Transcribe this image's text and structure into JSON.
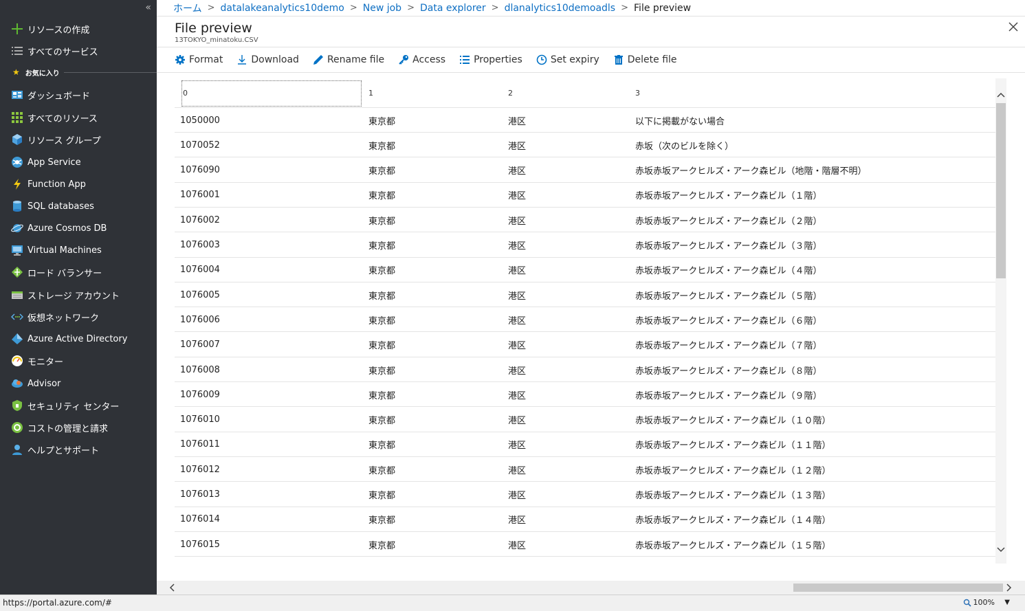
{
  "sidebar": {
    "collapse_glyph": "«",
    "top_items": [
      {
        "label": "リソースの作成",
        "icon": "plus-icon"
      },
      {
        "label": "すべてのサービス",
        "icon": "list-icon"
      }
    ],
    "favorites_label": "お気に入り",
    "items": [
      {
        "label": "ダッシュボード",
        "icon": "dashboard-icon"
      },
      {
        "label": "すべてのリソース",
        "icon": "grid-icon"
      },
      {
        "label": "リソース グループ",
        "icon": "cube-icon"
      },
      {
        "label": "App Service",
        "icon": "app-service-icon"
      },
      {
        "label": "Function App",
        "icon": "lightning-icon"
      },
      {
        "label": "SQL databases",
        "icon": "database-icon"
      },
      {
        "label": "Azure Cosmos DB",
        "icon": "planet-icon"
      },
      {
        "label": "Virtual Machines",
        "icon": "monitor-icon"
      },
      {
        "label": "ロード バランサー",
        "icon": "load-balancer-icon"
      },
      {
        "label": "ストレージ アカウント",
        "icon": "storage-icon"
      },
      {
        "label": "仮想ネットワーク",
        "icon": "network-icon"
      },
      {
        "label": "Azure Active Directory",
        "icon": "aad-icon"
      },
      {
        "label": "モニター",
        "icon": "gauge-icon"
      },
      {
        "label": "Advisor",
        "icon": "cloud-icon"
      },
      {
        "label": "セキュリティ センター",
        "icon": "shield-icon"
      },
      {
        "label": "コストの管理と請求",
        "icon": "cost-icon"
      },
      {
        "label": "ヘルプとサポート",
        "icon": "person-icon"
      }
    ]
  },
  "breadcrumb": {
    "items": [
      "ホーム",
      "datalakeanalytics10demo",
      "New job",
      "Data explorer",
      "dlanalytics10demoadls"
    ],
    "current": "File preview"
  },
  "blade": {
    "title": "File preview",
    "subtitle": "13TOKYO_minatoku.CSV"
  },
  "toolbar": {
    "format": "Format",
    "download": "Download",
    "rename": "Rename file",
    "access": "Access",
    "properties": "Properties",
    "set_expiry": "Set expiry",
    "delete": "Delete file"
  },
  "table": {
    "headers": [
      "0",
      "1",
      "2",
      "3"
    ],
    "rows": [
      [
        "1050000",
        "東京都",
        "港区",
        "以下に掲載がない場合"
      ],
      [
        "1070052",
        "東京都",
        "港区",
        "赤坂（次のビルを除く）"
      ],
      [
        "1076090",
        "東京都",
        "港区",
        "赤坂赤坂アークヒルズ・アーク森ビル（地階・階層不明）"
      ],
      [
        "1076001",
        "東京都",
        "港区",
        "赤坂赤坂アークヒルズ・アーク森ビル（１階）"
      ],
      [
        "1076002",
        "東京都",
        "港区",
        "赤坂赤坂アークヒルズ・アーク森ビル（２階）"
      ],
      [
        "1076003",
        "東京都",
        "港区",
        "赤坂赤坂アークヒルズ・アーク森ビル（３階）"
      ],
      [
        "1076004",
        "東京都",
        "港区",
        "赤坂赤坂アークヒルズ・アーク森ビル（４階）"
      ],
      [
        "1076005",
        "東京都",
        "港区",
        "赤坂赤坂アークヒルズ・アーク森ビル（５階）"
      ],
      [
        "1076006",
        "東京都",
        "港区",
        "赤坂赤坂アークヒルズ・アーク森ビル（６階）"
      ],
      [
        "1076007",
        "東京都",
        "港区",
        "赤坂赤坂アークヒルズ・アーク森ビル（７階）"
      ],
      [
        "1076008",
        "東京都",
        "港区",
        "赤坂赤坂アークヒルズ・アーク森ビル（８階）"
      ],
      [
        "1076009",
        "東京都",
        "港区",
        "赤坂赤坂アークヒルズ・アーク森ビル（９階）"
      ],
      [
        "1076010",
        "東京都",
        "港区",
        "赤坂赤坂アークヒルズ・アーク森ビル（１０階）"
      ],
      [
        "1076011",
        "東京都",
        "港区",
        "赤坂赤坂アークヒルズ・アーク森ビル（１１階）"
      ],
      [
        "1076012",
        "東京都",
        "港区",
        "赤坂赤坂アークヒルズ・アーク森ビル（１２階）"
      ],
      [
        "1076013",
        "東京都",
        "港区",
        "赤坂赤坂アークヒルズ・アーク森ビル（１３階）"
      ],
      [
        "1076014",
        "東京都",
        "港区",
        "赤坂赤坂アークヒルズ・アーク森ビル（１４階）"
      ],
      [
        "1076015",
        "東京都",
        "港区",
        "赤坂赤坂アークヒルズ・アーク森ビル（１５階）"
      ]
    ]
  },
  "statusbar": {
    "url": "https://portal.azure.com/#",
    "zoom": "100%"
  },
  "colors": {
    "sidebar_bg": "#2f3237",
    "link": "#0e6fc3",
    "accent": "#0072c6"
  }
}
